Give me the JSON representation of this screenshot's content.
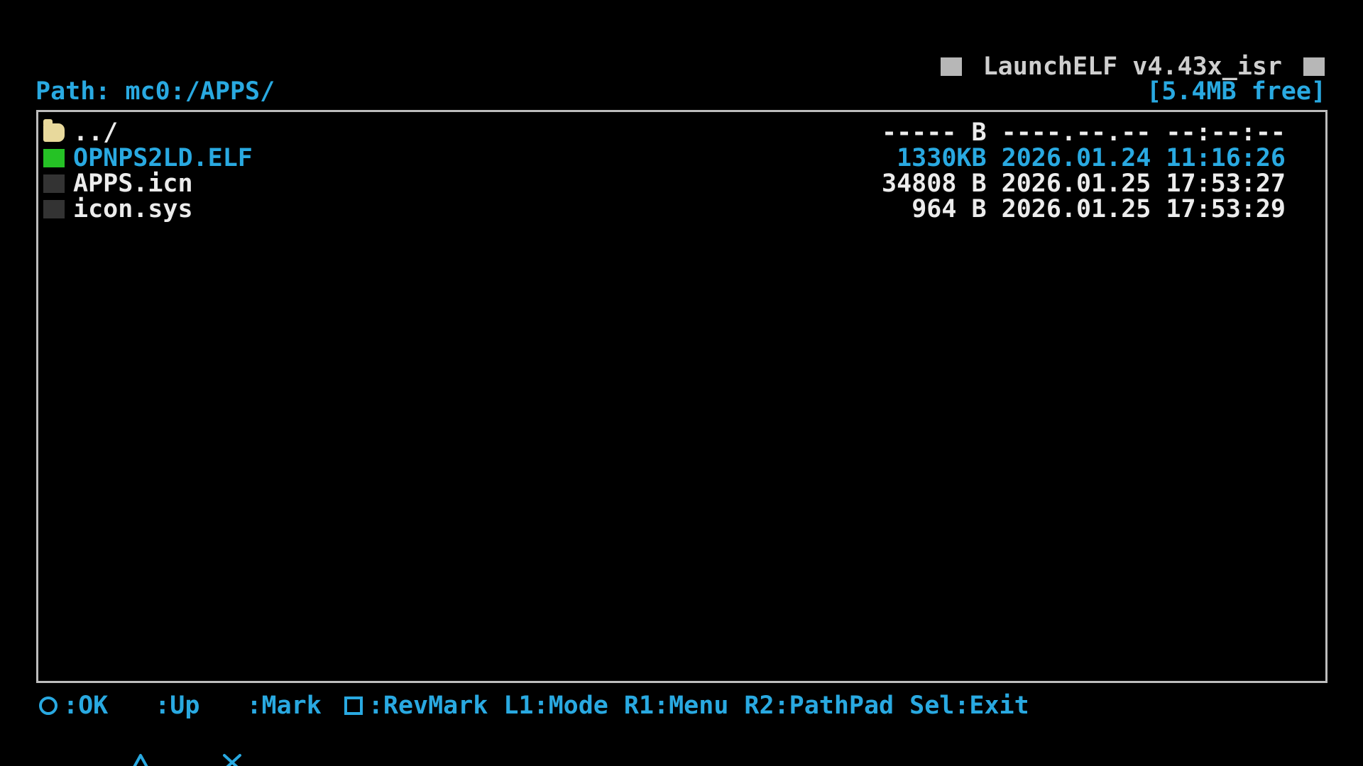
{
  "header": {
    "app_title": "LaunchELF v4.43x_isr",
    "path_label": "Path:",
    "path_value": "mc0:/APPS/",
    "free_space": "[5.4MB free]"
  },
  "files": [
    {
      "name": "../",
      "size": "----- B",
      "date": "----.--.--",
      "time": "--:--:--",
      "icon": "folder-icon",
      "selected": false
    },
    {
      "name": "OPNPS2LD.ELF",
      "size": "1330KB",
      "date": "2026.01.24",
      "time": "11:16:26",
      "icon": "elf-file-icon",
      "selected": true
    },
    {
      "name": "APPS.icn",
      "size": "34808 B",
      "date": "2026.01.25",
      "time": "17:53:27",
      "icon": "file-icon",
      "selected": false
    },
    {
      "name": "icon.sys",
      "size": "964 B",
      "date": "2026.01.25",
      "time": "17:53:29",
      "icon": "file-icon",
      "selected": false
    }
  ],
  "footer": {
    "hints": [
      {
        "button": "circle-button-icon",
        "label": ":OK"
      },
      {
        "button": "triangle-button-icon",
        "label": ":Up"
      },
      {
        "button": "cross-button-icon",
        "label": ":Mark"
      },
      {
        "button": "square-button-icon",
        "label": ":RevMark"
      },
      {
        "button": "",
        "label": "L1:Mode"
      },
      {
        "button": "",
        "label": "R1:Menu"
      },
      {
        "button": "",
        "label": "R2:PathPad"
      },
      {
        "button": "",
        "label": "Sel:Exit"
      }
    ]
  },
  "colors": {
    "background": "#000000",
    "accent_blue": "#29a9e1",
    "text_white": "#ececec",
    "elf_green": "#25c225",
    "folder_yellow": "#e8d99c",
    "border_gray": "#bdbdbd"
  }
}
